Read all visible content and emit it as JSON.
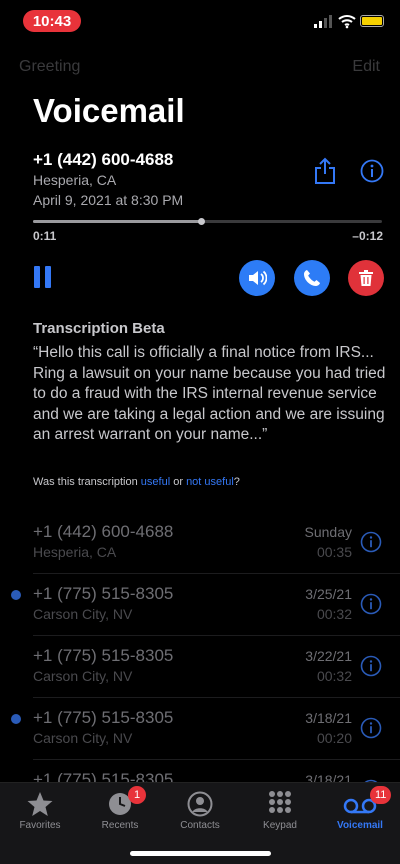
{
  "status": {
    "time": "10:43"
  },
  "nav": {
    "greeting": "Greeting",
    "edit": "Edit"
  },
  "title": "Voicemail",
  "detail": {
    "number": "+1 (442) 600-4688",
    "location": "Hesperia, CA",
    "date": "April 9, 2021 at 8:30 PM",
    "elapsed": "0:11",
    "remaining": "–0:12",
    "progress_fraction": 0.48
  },
  "transcription": {
    "heading": "Transcription Beta",
    "body": "“Hello this call is officially a final notice from IRS... Ring a lawsuit on your name because you had tried to do a fraud with the IRS internal revenue service and we are taking a legal action and we are issuing an arrest warrant on your name...”",
    "feedback_prefix": "Was this transcription ",
    "useful": "useful",
    "or": " or ",
    "not_useful": "not useful",
    "suffix": "?"
  },
  "voicemails": [
    {
      "number": "+1 (442) 600-4688",
      "location": "Hesperia, CA",
      "date": "Sunday",
      "duration": "00:35",
      "unread": false
    },
    {
      "number": "+1 (775) 515-8305",
      "location": "Carson City, NV",
      "date": "3/25/21",
      "duration": "00:32",
      "unread": true
    },
    {
      "number": "+1 (775) 515-8305",
      "location": "Carson City, NV",
      "date": "3/22/21",
      "duration": "00:32",
      "unread": false
    },
    {
      "number": "+1 (775) 515-8305",
      "location": "Carson City, NV",
      "date": "3/18/21",
      "duration": "00:20",
      "unread": true
    },
    {
      "number": "+1 (775) 515-8305",
      "location": "",
      "date": "3/18/21",
      "duration": "",
      "unread": false
    }
  ],
  "tabs": [
    {
      "label": "Favorites",
      "icon": "star-icon"
    },
    {
      "label": "Recents",
      "icon": "clock-icon",
      "badge": "1"
    },
    {
      "label": "Contacts",
      "icon": "person-circle-icon"
    },
    {
      "label": "Keypad",
      "icon": "keypad-icon"
    },
    {
      "label": "Voicemail",
      "icon": "voicemail-icon",
      "badge": "11",
      "active": true
    }
  ],
  "colors": {
    "accent": "#3478f6",
    "delete": "#e0323a",
    "badge": "#e8333a",
    "battery": "#f5d000"
  }
}
